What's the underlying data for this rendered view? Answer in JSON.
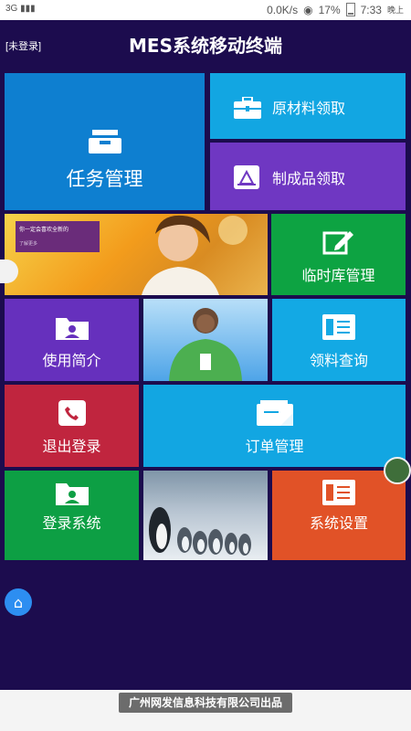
{
  "status_bar": {
    "network": "3G",
    "speed": "0.0K/s",
    "battery": "17%",
    "time": "7:33",
    "period": "晚上"
  },
  "header": {
    "login_status": "[未登录]",
    "title": "MES系统移动终端"
  },
  "tiles": {
    "task": "任务管理",
    "raw_materials": "原材料领取",
    "finished_goods": "制成品领取",
    "temp_storage": "临时库管理",
    "intro": "使用简介",
    "material_query": "领料查询",
    "logout": "退出登录",
    "orders": "订单管理",
    "login": "登录系统",
    "settings": "系统设置"
  },
  "banner": {
    "text": "你一定会喜欢全新的",
    "subtext": "了解更多"
  },
  "footer": {
    "credit": "广州网发信息科技有限公司出品"
  }
}
